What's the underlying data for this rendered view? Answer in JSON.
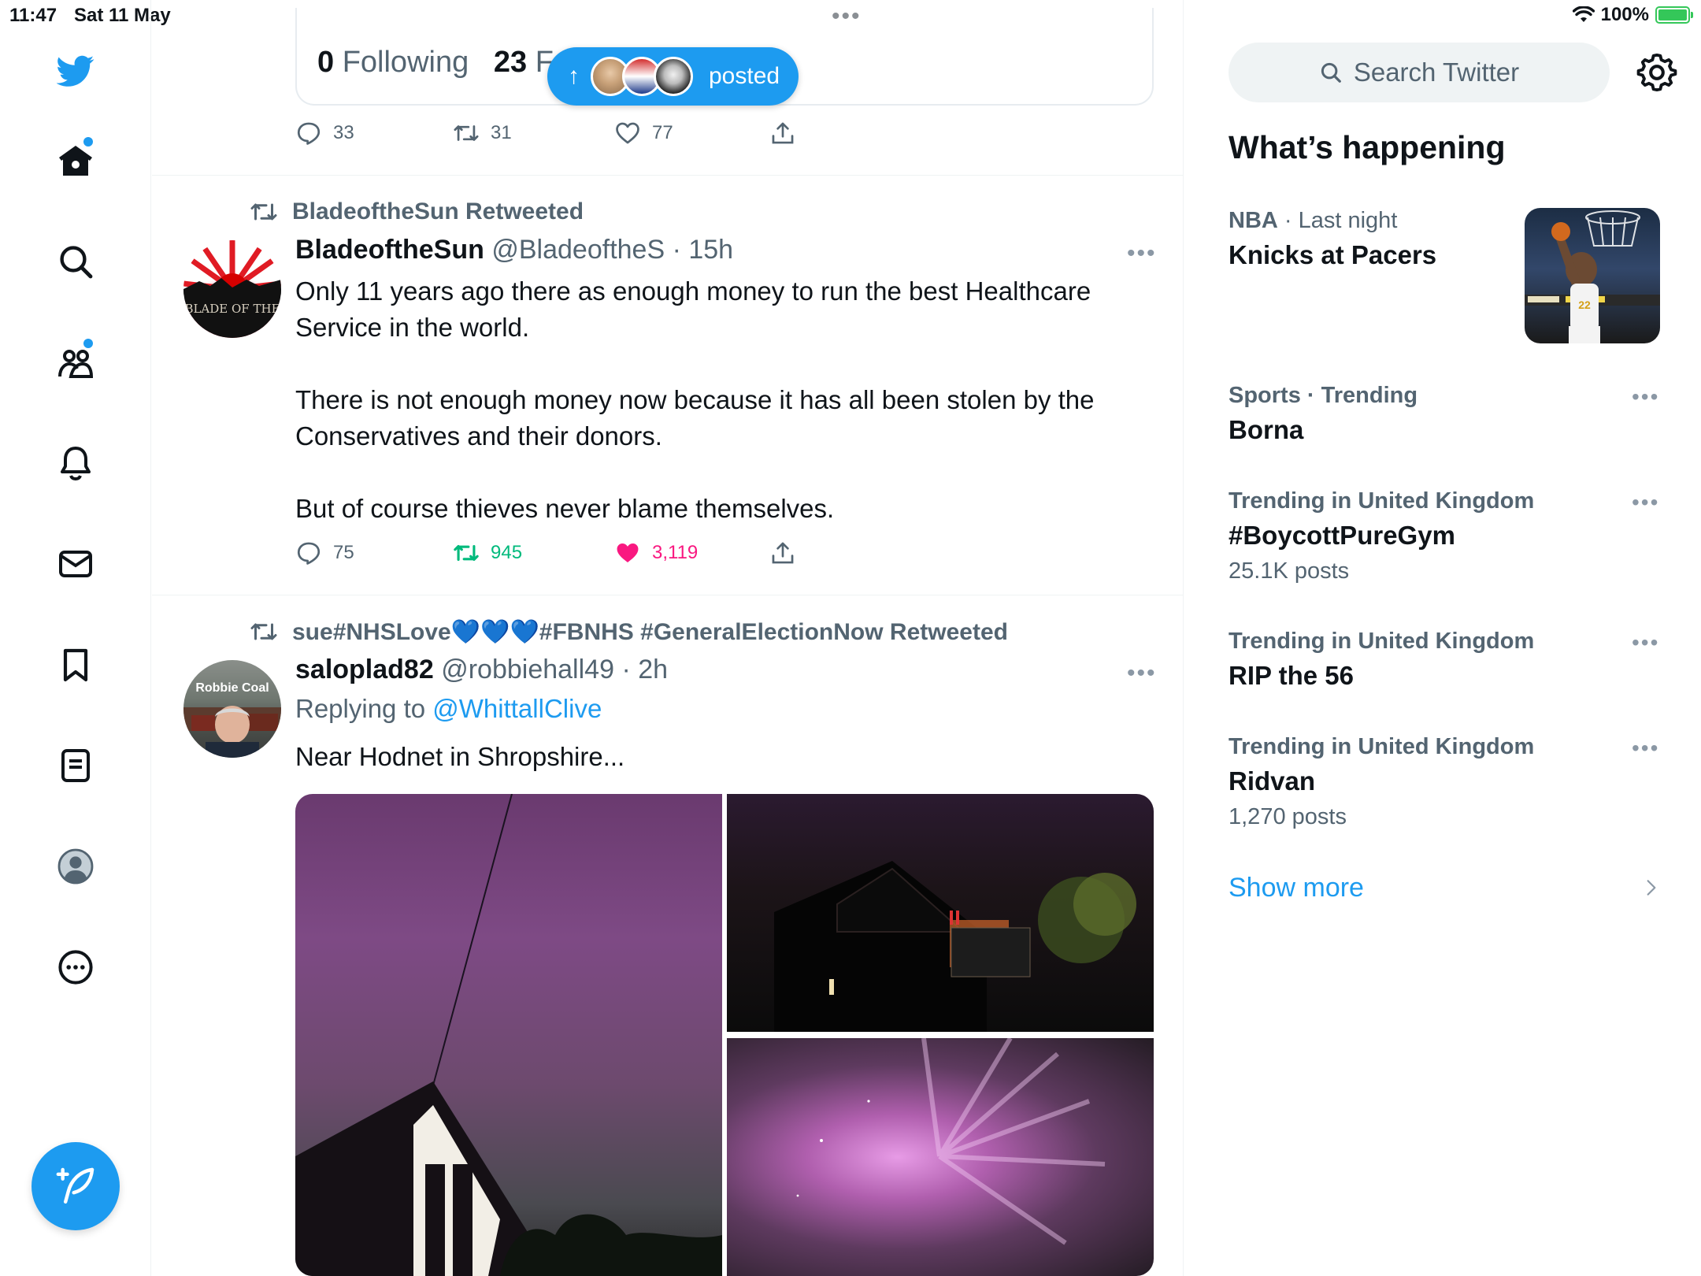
{
  "status_bar": {
    "time": "11:47",
    "date": "Sat 11 May",
    "multitask_dots": "•••",
    "battery_percent": "100%",
    "battery_level": 1.0
  },
  "nav": {
    "items": [
      {
        "icon": "twitter-bird-icon"
      },
      {
        "icon": "home-icon",
        "unread_dot": true
      },
      {
        "icon": "search-icon"
      },
      {
        "icon": "communities-icon",
        "unread_dot": true
      },
      {
        "icon": "bell-icon"
      },
      {
        "icon": "mail-icon"
      },
      {
        "icon": "bookmark-icon"
      },
      {
        "icon": "lists-icon"
      },
      {
        "icon": "profile-icon"
      },
      {
        "icon": "more-icon"
      }
    ],
    "compose_icon": "compose-icon"
  },
  "profile_card": {
    "following_count": "0",
    "following_label": "Following",
    "followers_count": "23",
    "followers_label_partial": "F"
  },
  "new_posts_pill": {
    "label": "posted",
    "arrow": "↑"
  },
  "prev_tweet_actions": {
    "replies": "33",
    "retweets": "31",
    "likes": "77"
  },
  "tweets": [
    {
      "retweeted_by": "BladeoftheSun Retweeted",
      "name": "BladeoftheSun",
      "handle": "@BladeoftheS",
      "time": "· 15h",
      "more": "•••",
      "avatar_text": "BLADE OF THE",
      "paragraphs": [
        "Only 11 years ago there as enough money to run the best Healthcare Service in the world.",
        "There is not enough money now because it has all been stolen by the Conservatives and their donors.",
        "But of course thieves never blame themselves."
      ],
      "replies": "75",
      "retweets": "945",
      "likes": "3,119",
      "retweeted": true,
      "liked": true
    },
    {
      "retweeted_by": "sue#NHSLove💙💙💙#FBNHS #GeneralElectionNow Retweeted",
      "name": "saloplad82",
      "handle": "@robbiehall49",
      "time": "· 2h",
      "more": "•••",
      "avatar_text": "Robbie Coal",
      "replying_prefix": "Replying to ",
      "replying_to": "@WhittallClive",
      "text": "Near Hodnet in Shropshire..."
    }
  ],
  "sidebar": {
    "search_placeholder": "Search Twitter",
    "section_title": "What’s happening",
    "trends": [
      {
        "category": "NBA",
        "context": " · Last night",
        "title": "Knicks at Pacers",
        "count": "",
        "has_image": true
      },
      {
        "category": "",
        "context": "Sports · Trending",
        "title": "Borna",
        "count": "",
        "more": "•••"
      },
      {
        "category": "",
        "context": "Trending in United Kingdom",
        "title": "#BoycottPureGym",
        "count": "25.1K posts",
        "more": "•••"
      },
      {
        "category": "",
        "context": "Trending in United Kingdom",
        "title": "RIP the 56",
        "count": "",
        "more": "•••"
      },
      {
        "category": "",
        "context": "Trending in United Kingdom",
        "title": "Ridvan",
        "count": "1,270 posts",
        "more": "•••"
      }
    ],
    "show_more": "Show more"
  },
  "colors": {
    "accent": "#1d9bf0",
    "retweet_green": "#00ba7c",
    "like_pink": "#f91880",
    "secondary_text": "#536471"
  }
}
